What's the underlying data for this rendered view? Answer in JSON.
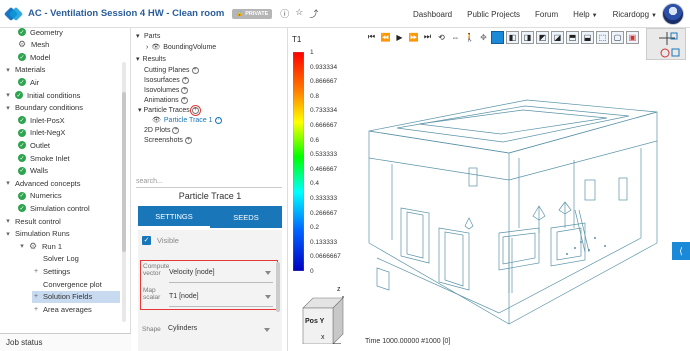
{
  "header": {
    "title": "AC - Ventilation Session 4 HW - Clean room",
    "badge": "PRIVATE",
    "nav": [
      "Dashboard",
      "Public Projects",
      "Forum",
      "Help",
      "Ricardopg"
    ]
  },
  "sidebar": {
    "items": [
      {
        "label": "Geometry",
        "icon": "check",
        "indent": 1
      },
      {
        "label": "Mesh",
        "icon": "gears",
        "indent": 1
      },
      {
        "label": "Model",
        "icon": "check",
        "indent": 1
      },
      {
        "label": "Materials",
        "icon": "expand",
        "indent": 0
      },
      {
        "label": "Air",
        "icon": "check",
        "indent": 1
      },
      {
        "label": "Initial conditions",
        "icon": "expand-check",
        "indent": 0
      },
      {
        "label": "Boundary conditions",
        "icon": "expand",
        "indent": 0
      },
      {
        "label": "Inlet-PosX",
        "icon": "check",
        "indent": 1
      },
      {
        "label": "Inlet-NegX",
        "icon": "check",
        "indent": 1
      },
      {
        "label": "Outlet",
        "icon": "check",
        "indent": 1
      },
      {
        "label": "Smoke Inlet",
        "icon": "check",
        "indent": 1
      },
      {
        "label": "Walls",
        "icon": "check",
        "indent": 1
      },
      {
        "label": "Advanced concepts",
        "icon": "expand",
        "indent": 0
      },
      {
        "label": "Numerics",
        "icon": "check",
        "indent": 1
      },
      {
        "label": "Simulation control",
        "icon": "check",
        "indent": 1
      },
      {
        "label": "Result control",
        "icon": "expand",
        "indent": 0
      },
      {
        "label": "Simulation Runs",
        "icon": "expand",
        "indent": 0
      },
      {
        "label": "Run 1",
        "icon": "expand-gears",
        "indent": 1
      },
      {
        "label": "Solver Log",
        "icon": "none",
        "indent": 2
      },
      {
        "label": "Settings",
        "icon": "plus",
        "indent": 2
      },
      {
        "label": "Convergence plot",
        "icon": "none",
        "indent": 2
      },
      {
        "label": "Solution Fields",
        "icon": "plus",
        "indent": 2,
        "selected": true
      },
      {
        "label": "Area averages",
        "icon": "plus",
        "indent": 2
      }
    ],
    "job_status": "Job status"
  },
  "post_tree": {
    "parts": "Parts",
    "bounding_volume": "BoundingVolume",
    "results": "Results",
    "cutting_planes": "Cutting Planes",
    "isosurfaces": "Isosurfaces",
    "isovolumes": "Isovolumes",
    "animations": "Animations",
    "particle_traces": "Particle Traces",
    "particle_trace_1": "Particle Trace 1",
    "plots_2d": "2D Plots",
    "screenshots": "Screenshots",
    "search_placeholder": "search..."
  },
  "panel": {
    "title": "Particle Trace 1",
    "tabs": [
      "SETTINGS",
      "SEEDS"
    ],
    "visible_label": "Visible",
    "compute_vector_label": "Compute vector",
    "compute_vector_value": "Velocity [node]",
    "map_scalar_label": "Map scalar",
    "map_scalar_value": "T1 [node]",
    "shape_label": "Shape",
    "shape_value": "Cylinders"
  },
  "viewer": {
    "colorbar_title": "T1",
    "colorbar_ticks": [
      "1",
      "0.933334",
      "0.866667",
      "0.8",
      "0.733334",
      "0.666667",
      "0.6",
      "0.533333",
      "0.466667",
      "0.4",
      "0.333333",
      "0.266667",
      "0.2",
      "0.133333",
      "0.0666667",
      "0"
    ],
    "orientation_label": "Pos Y",
    "axis_x": "x",
    "axis_z": "z",
    "time_readout": "Time 1000.00000  #1000 [0]"
  },
  "colors": {
    "accent": "#1976b9",
    "highlight_red": "#e53935",
    "model_lines": "#5b93a8",
    "selected_row": "#c7daf0"
  }
}
